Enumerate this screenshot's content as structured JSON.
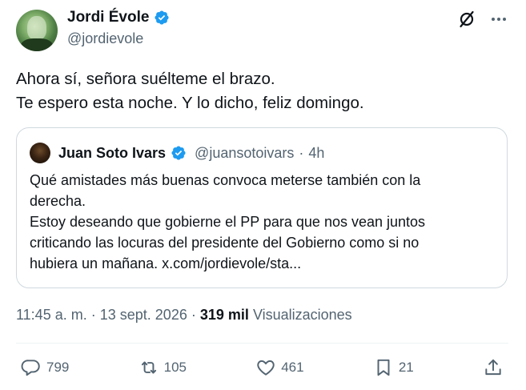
{
  "author": {
    "name": "Jordi Évole",
    "handle": "@jordievole",
    "avatar_icon": "avatar-photo",
    "verified_color": "#1d9bf0"
  },
  "header_icons": [
    "grok-icon",
    "more-icon"
  ],
  "tweet": {
    "lines": [
      "Ahora sí, señora suélteme el brazo.",
      "Te espero esta noche. Y lo dicho, feliz domingo."
    ]
  },
  "quote": {
    "name": "Juan Soto Ivars",
    "handle": "@juansotoivars",
    "separator": "·",
    "time": "4h",
    "lines": [
      "Qué amistades más buenas convoca meterse también con la",
      "derecha.",
      "Estoy deseando que gobierne el PP para que nos vean juntos",
      "criticando las locuras del presidente del Gobierno como si no",
      "hubiera un mañana. x.com/jordievole/sta..."
    ]
  },
  "meta": {
    "time": "11:45 a. m.",
    "separator": "·",
    "date": "13 sept. 2026",
    "views_count": "319 mil",
    "views_label": "Visualizaciones"
  },
  "actions": {
    "replies": "799",
    "reposts": "105",
    "likes": "461",
    "bookmarks": "21"
  },
  "colors": {
    "text": "#0f1419",
    "secondary": "#536471",
    "border": "#cfd9de",
    "accent": "#1d9bf0"
  }
}
